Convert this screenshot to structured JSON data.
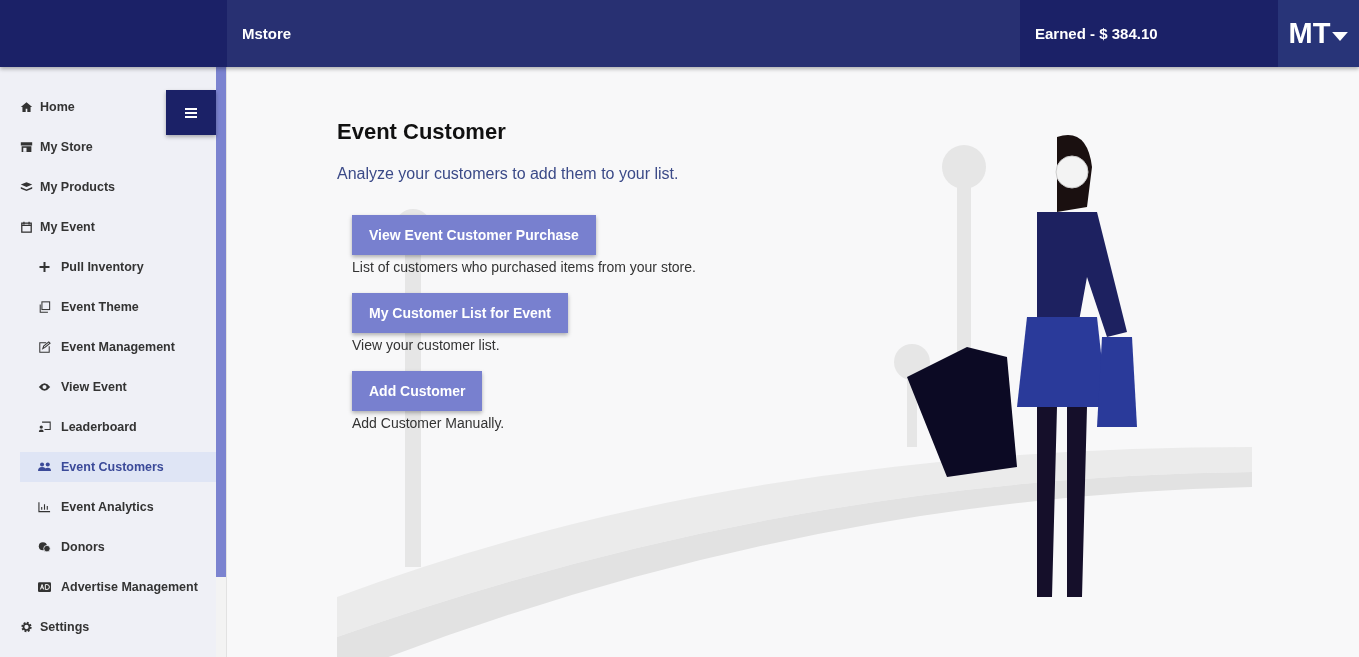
{
  "header": {
    "brand": "Mstore",
    "earned": "Earned - $ 384.10",
    "avatar": "MT"
  },
  "sidebar": {
    "items": [
      {
        "label": "Home",
        "selected": false
      },
      {
        "label": "My Store",
        "selected": false
      },
      {
        "label": "My Products",
        "selected": false
      },
      {
        "label": "My Event",
        "selected": false,
        "children": [
          {
            "label": "Pull Inventory",
            "selected": false
          },
          {
            "label": "Event Theme",
            "selected": false
          },
          {
            "label": "Event Management",
            "selected": false
          },
          {
            "label": "View Event",
            "selected": false
          },
          {
            "label": "Leaderboard",
            "selected": false
          },
          {
            "label": "Event Customers",
            "selected": true
          },
          {
            "label": "Event Analytics",
            "selected": false
          },
          {
            "label": "Donors",
            "selected": false
          },
          {
            "label": "Advertise Management",
            "selected": false
          }
        ]
      },
      {
        "label": "Settings",
        "selected": false
      }
    ]
  },
  "main": {
    "title": "Event Customer",
    "subtitle": "Analyze your customers to add them to your list.",
    "actions": [
      {
        "button": "View Event Customer Purchase",
        "description": "List of customers who purchased items from your store."
      },
      {
        "button": "My Customer List for Event",
        "description": "View your customer list."
      },
      {
        "button": "Add Customer",
        "description": "Add Customer Manually."
      }
    ]
  }
}
